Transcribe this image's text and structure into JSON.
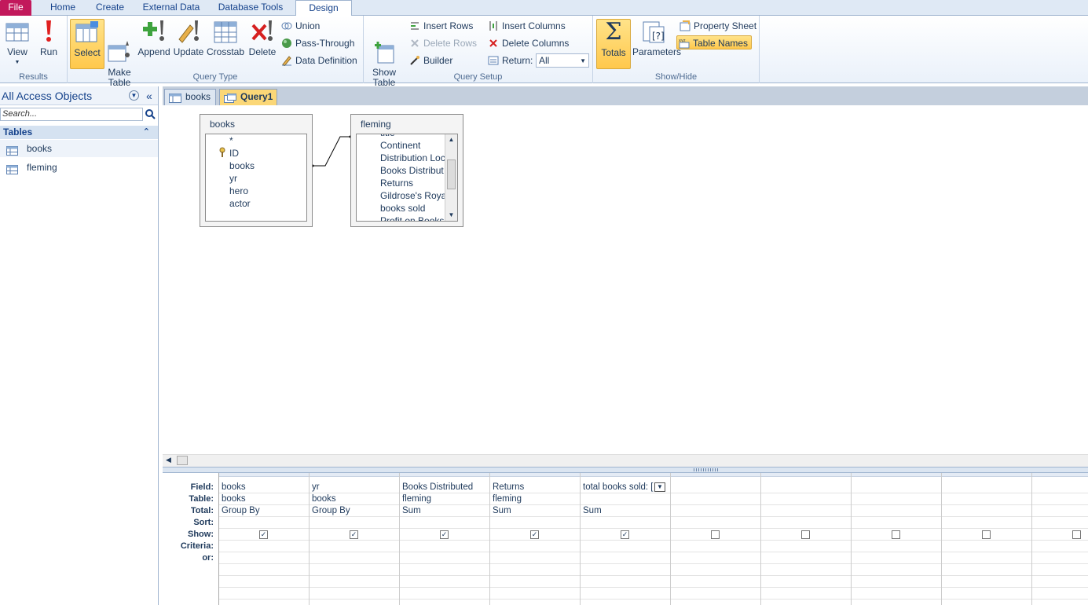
{
  "ribbon_tabs": [
    "File",
    "Home",
    "Create",
    "External Data",
    "Database Tools",
    "Design"
  ],
  "groups": {
    "results": {
      "title": "Results",
      "view": "View",
      "run": "Run"
    },
    "query_type": {
      "title": "Query Type",
      "select": "Select",
      "make_table": "Make\nTable",
      "append": "Append",
      "update": "Update",
      "crosstab": "Crosstab",
      "delete": "Delete",
      "union": "Union",
      "pass_through": "Pass-Through",
      "data_definition": "Data Definition"
    },
    "query_setup": {
      "title": "Query Setup",
      "show_table": "Show\nTable",
      "insert_rows": "Insert Rows",
      "delete_rows": "Delete Rows",
      "builder": "Builder",
      "insert_columns": "Insert Columns",
      "delete_columns": "Delete Columns",
      "return_label": "Return:",
      "return_value": "All"
    },
    "show_hide": {
      "title": "Show/Hide",
      "totals": "Totals",
      "parameters": "Parameters",
      "property_sheet": "Property Sheet",
      "table_names": "Table Names"
    }
  },
  "nav": {
    "header": "All Access Objects",
    "search_placeholder": "Search...",
    "section": "Tables",
    "items": [
      "books",
      "fleming"
    ]
  },
  "doc_tabs": [
    "books",
    "Query1"
  ],
  "field_lists": [
    {
      "title": "books",
      "fields": [
        "*",
        "ID",
        "books",
        "yr",
        "hero",
        "actor"
      ]
    },
    {
      "title": "fleming",
      "fields": [
        "title",
        "Continent",
        "Distribution Loc",
        "Books Distribut",
        "Returns",
        "Gildrose's Roya",
        "books sold",
        "Profit on Books"
      ]
    }
  ],
  "grid": {
    "row_labels": [
      "Field:",
      "Table:",
      "Total:",
      "Sort:",
      "Show:",
      "Criteria:",
      "or:"
    ],
    "columns": [
      {
        "field": "books",
        "table": "books",
        "total": "Group By",
        "show": true
      },
      {
        "field": "yr",
        "table": "books",
        "total": "Group By",
        "show": true
      },
      {
        "field": "Books Distributed",
        "table": "fleming",
        "total": "Sum",
        "show": true
      },
      {
        "field": "Returns",
        "table": "fleming",
        "total": "Sum",
        "show": true
      },
      {
        "field": "total books sold: [",
        "table": "",
        "total": "Sum",
        "show": true
      },
      {
        "field": "",
        "table": "",
        "total": "",
        "show": false
      },
      {
        "field": "",
        "table": "",
        "total": "",
        "show": false
      },
      {
        "field": "",
        "table": "",
        "total": "",
        "show": false
      },
      {
        "field": "",
        "table": "",
        "total": "",
        "show": false
      },
      {
        "field": "",
        "table": "",
        "total": "",
        "show": false
      }
    ]
  },
  "colors": {
    "file_tab": "#c2185b",
    "active_button": "#ffc84c",
    "accent": "#15428b"
  }
}
